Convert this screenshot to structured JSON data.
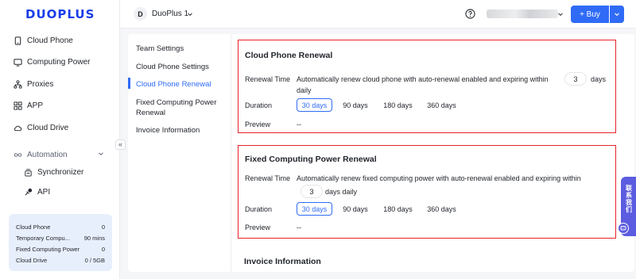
{
  "app": {
    "logo_text": "DUOPLUS",
    "brand_color": "#2f6bf6",
    "highlight_color": "#e8222b"
  },
  "sidebar": {
    "items": [
      {
        "label": "Cloud Phone",
        "icon": "phone-icon"
      },
      {
        "label": "Computing Power",
        "icon": "monitor-icon"
      },
      {
        "label": "Proxies",
        "icon": "network-icon"
      },
      {
        "label": "APP",
        "icon": "grid-icon"
      },
      {
        "label": "Cloud Drive",
        "icon": "cloud-icon"
      }
    ],
    "automation": {
      "label": "Automation",
      "children": [
        {
          "label": "Synchronizer",
          "icon": "synchronizer-icon"
        },
        {
          "label": "API",
          "icon": "api-icon"
        }
      ]
    },
    "collapse_glyph": "«",
    "summary": [
      {
        "label": "Cloud Phone",
        "value": "0"
      },
      {
        "label": "Temporary Compu...",
        "value": "90 mins"
      },
      {
        "label": "Fixed Computing Power",
        "value": "0"
      },
      {
        "label": "Cloud Drive",
        "value": "0 / 5GB"
      }
    ]
  },
  "topbar": {
    "workspace_initial": "D",
    "workspace_name": "DuoPlus 1",
    "buy_label": "+ Buy"
  },
  "settings_menu": {
    "items": [
      {
        "label": "Team Settings"
      },
      {
        "label": "Cloud Phone Settings"
      },
      {
        "label": "Cloud Phone Renewal",
        "active": true
      },
      {
        "label": "Fixed Computing Power Renewal"
      },
      {
        "label": "Invoice Information"
      }
    ]
  },
  "cloud_phone_renewal": {
    "title": "Cloud Phone Renewal",
    "renewal_time_label": "Renewal Time",
    "renewal_text_before": "Automatically renew cloud phone with auto-renewal enabled and expiring within",
    "days_value": "3",
    "days_suffix": "days",
    "daily": "daily",
    "duration_label": "Duration",
    "durations": [
      "30 days",
      "90 days",
      "180 days",
      "360 days"
    ],
    "selected_duration": "30 days",
    "preview_label": "Preview",
    "preview_value": "--"
  },
  "fixed_power_renewal": {
    "title": "Fixed Computing Power Renewal",
    "renewal_time_label": "Renewal Time",
    "renewal_text_before": "Automatically renew fixed computing power with auto-renewal enabled and expiring within",
    "days_value": "3",
    "days_suffix": "days daily",
    "duration_label": "Duration",
    "durations": [
      "30 days",
      "90 days",
      "180 days",
      "360 days"
    ],
    "selected_duration": "30 days",
    "preview_label": "Preview",
    "preview_value": "--"
  },
  "invoice_section_title": "Invoice Information",
  "contact_widget": {
    "label": "联系我们"
  }
}
